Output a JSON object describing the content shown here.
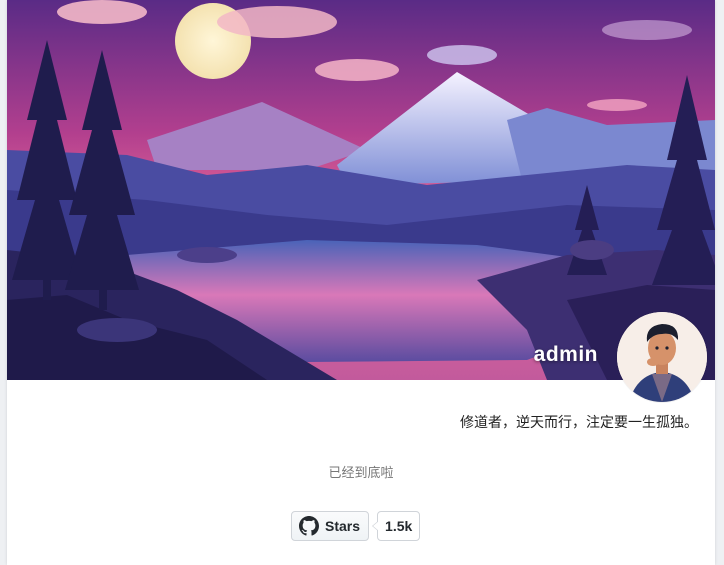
{
  "profile": {
    "username": "admin",
    "bio": "修道者，逆天而行，注定要一生孤独。"
  },
  "footer": {
    "end_text": "已经到底啦"
  },
  "github": {
    "button_label": "Stars",
    "count": "1.5k",
    "icon": "github-icon"
  },
  "colors": {
    "sky_top": "#6b2f8f",
    "sky_pink": "#e8608f",
    "mountain": "#3b56a8",
    "text_main": "#222222",
    "text_muted": "#777777"
  }
}
